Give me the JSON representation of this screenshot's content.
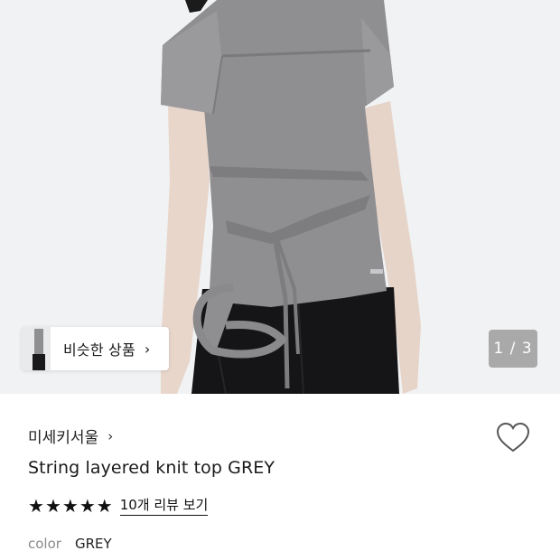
{
  "hero": {
    "similar_button": {
      "label": "비슷한 상품",
      "chevron": "›"
    },
    "image_counter": "1 / 3"
  },
  "product": {
    "brand": "미세키서울",
    "brand_chevron": "›",
    "title": "String layered knit top GREY",
    "rating": {
      "stars": [
        "★",
        "★",
        "★",
        "★",
        "★"
      ],
      "review_link": "10개 리뷰 보기"
    },
    "color": {
      "label": "color",
      "value": "GREY"
    },
    "wishlist_icon": "heart-outline-icon"
  },
  "colors": {
    "stars": "#111111",
    "shirt": "#8e8e90",
    "skirt": "#151517",
    "skin": "#e7d6cb"
  }
}
